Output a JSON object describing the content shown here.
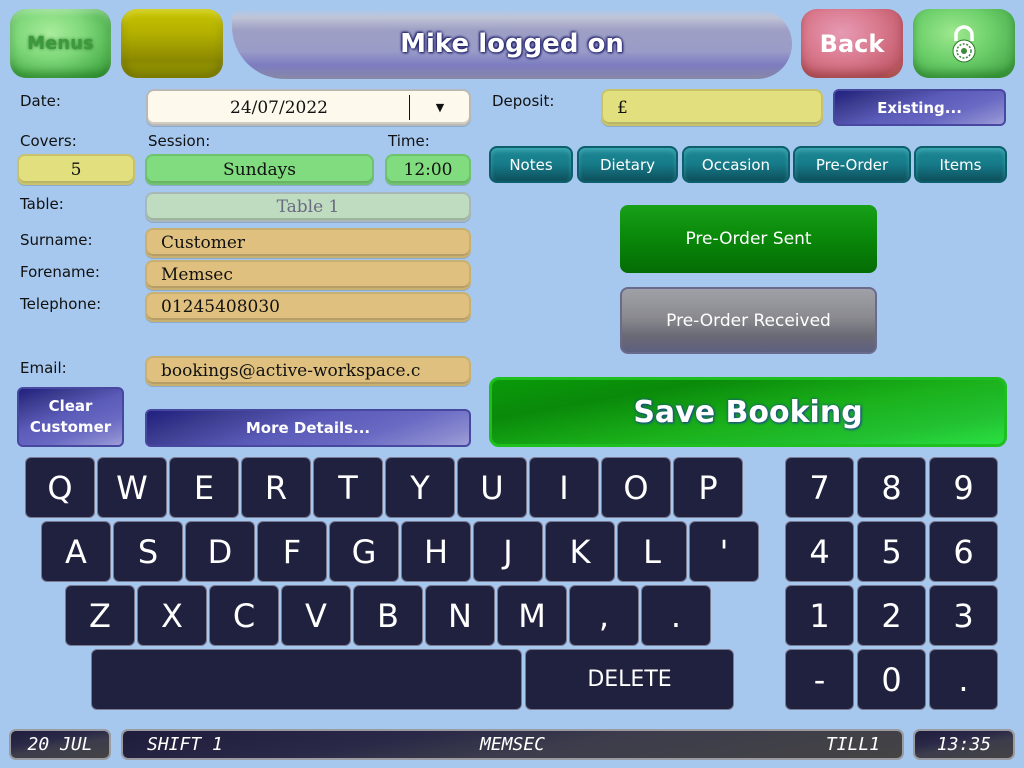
{
  "header": {
    "menus_label": "Menus",
    "title": "Mike logged on",
    "back_label": "Back",
    "lock_icon": "padlock-icon"
  },
  "form": {
    "date_label": "Date:",
    "date_value": "24/07/2022",
    "date_dropdown_icon": "▼",
    "deposit_label": "Deposit:",
    "deposit_value": "£",
    "existing_label": "Existing...",
    "covers_label": "Covers:",
    "covers_value": "5",
    "session_label": "Session:",
    "session_value": "Sundays",
    "time_label": "Time:",
    "time_value": "12:00",
    "table_label": "Table:",
    "table_value": "Table 1",
    "surname_label": "Surname:",
    "surname_value": "Customer",
    "forename_label": "Forename:",
    "forename_value": "Memsec",
    "telephone_label": "Telephone:",
    "telephone_value": "01245408030",
    "email_label": "Email:",
    "email_value": "bookings@active-workspace.c",
    "clear_customer_line1": "Clear",
    "clear_customer_line2": "Customer",
    "more_details_label": "More Details..."
  },
  "tabs": [
    {
      "label": "Notes"
    },
    {
      "label": "Dietary"
    },
    {
      "label": "Occasion"
    },
    {
      "label": "Pre-Order"
    },
    {
      "label": "Items"
    }
  ],
  "actions": {
    "preorder_sent": "Pre-Order Sent",
    "preorder_received": "Pre-Order Received",
    "save_booking": "Save Booking"
  },
  "keyboard": {
    "row1": [
      "Q",
      "W",
      "E",
      "R",
      "T",
      "Y",
      "U",
      "I",
      "O",
      "P"
    ],
    "row2": [
      "A",
      "S",
      "D",
      "F",
      "G",
      "H",
      "J",
      "K",
      "L",
      "'"
    ],
    "row3": [
      "Z",
      "X",
      "C",
      "V",
      "B",
      "N",
      "M",
      ",",
      "."
    ],
    "space": "",
    "delete": "DELETE"
  },
  "numpad": [
    "7",
    "8",
    "9",
    "4",
    "5",
    "6",
    "1",
    "2",
    "3",
    "-",
    "0",
    "."
  ],
  "status_bar": {
    "date": "20 JUL",
    "shift": "SHIFT 1",
    "user": "MEMSEC",
    "till": "TILL1",
    "time": "13:35"
  }
}
